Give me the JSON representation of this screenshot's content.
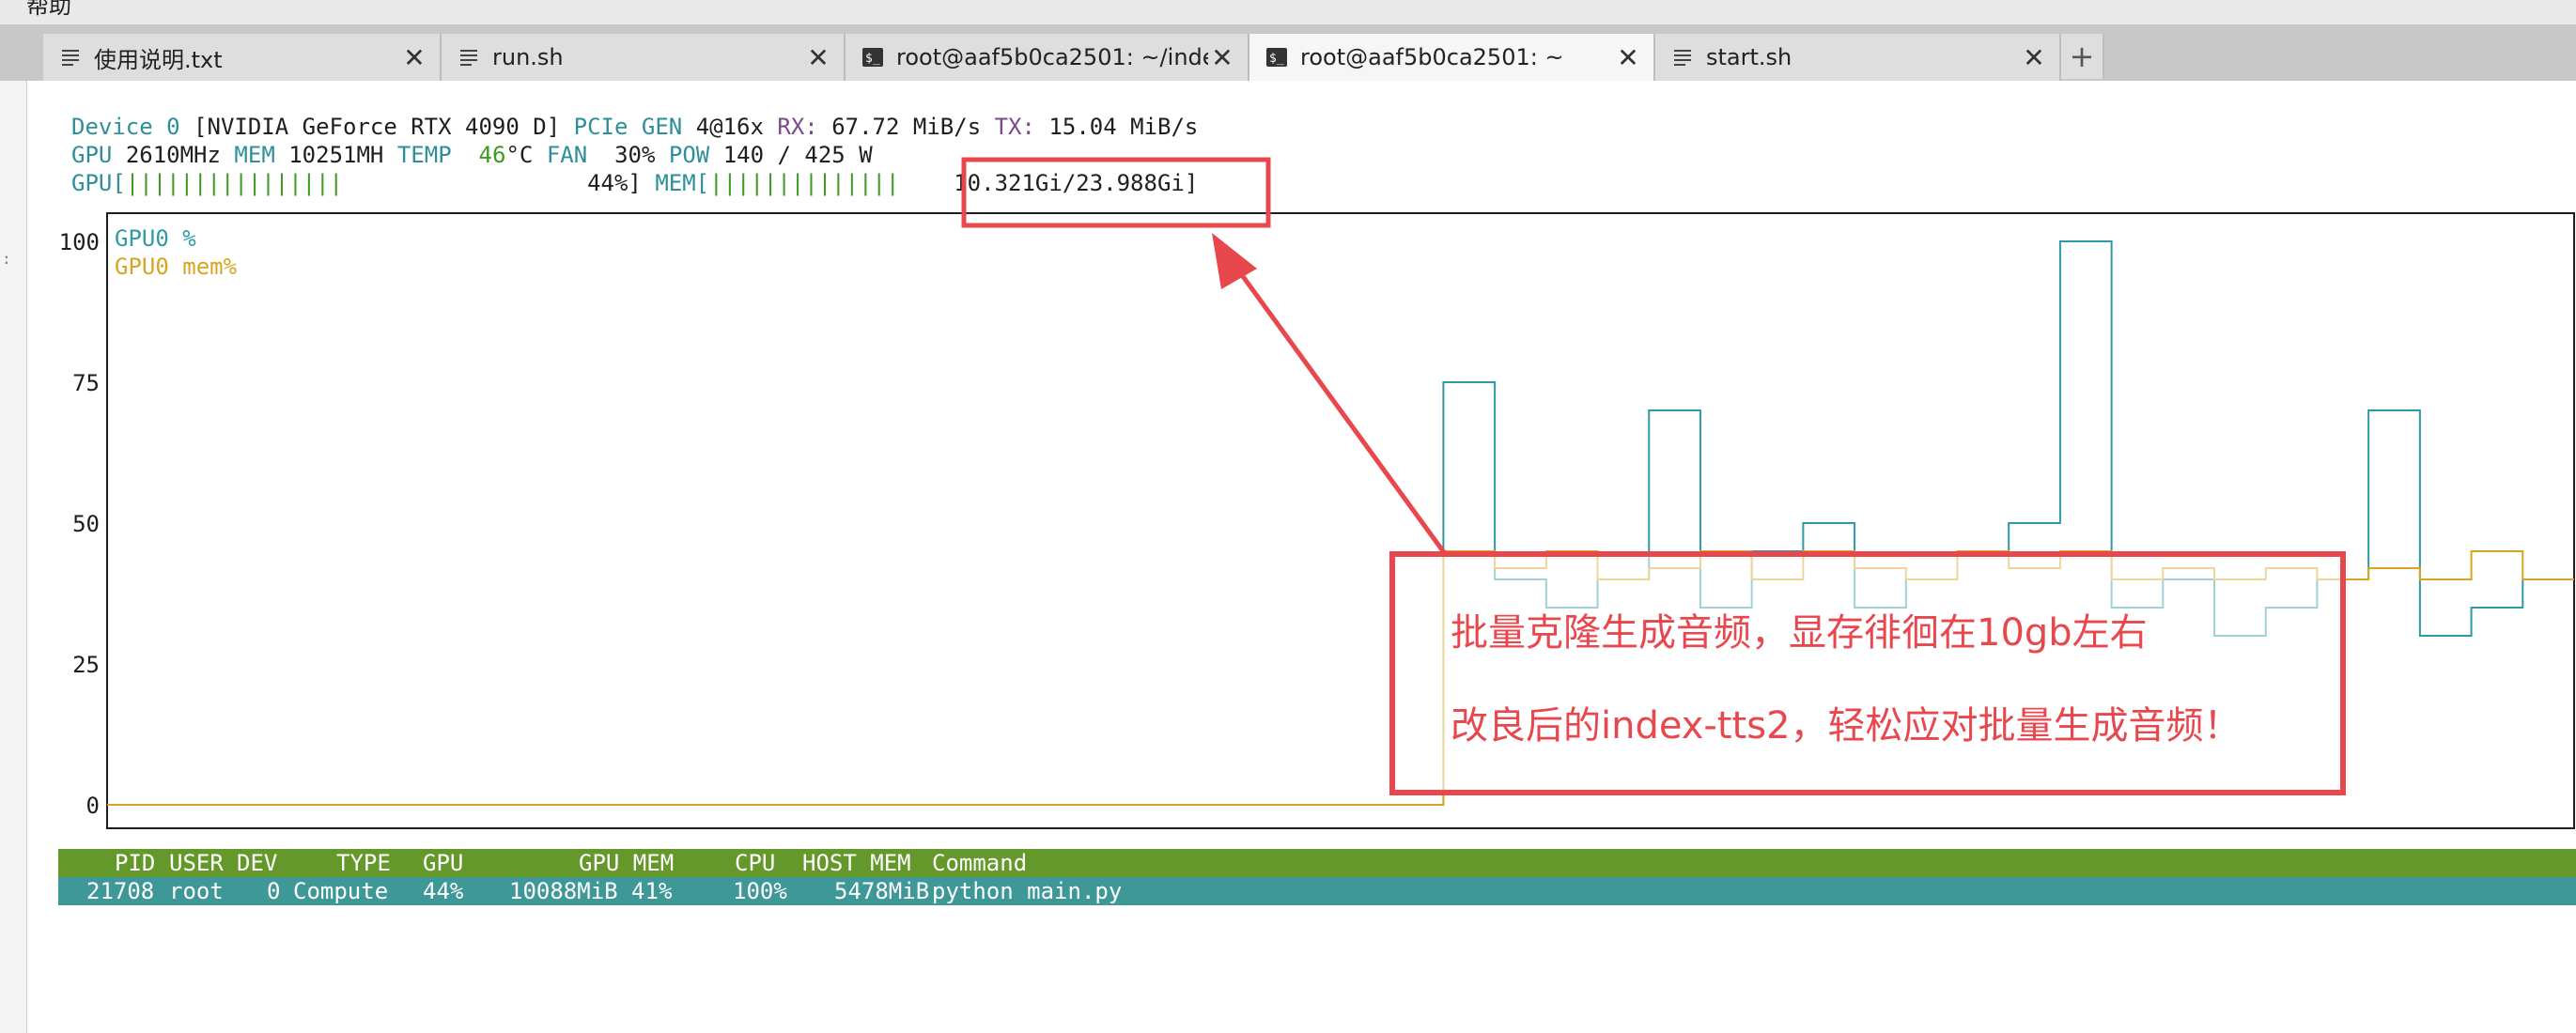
{
  "menubar": {
    "label": "帮助"
  },
  "tabs": [
    {
      "title": "使用说明.txt",
      "icon": "text-file-icon",
      "active": false
    },
    {
      "title": "run.sh",
      "icon": "text-file-icon",
      "active": false
    },
    {
      "title": "root@aaf5b0ca2501: ~/inde",
      "icon": "terminal-icon",
      "active": false
    },
    {
      "title": "root@aaf5b0ca2501: ~",
      "icon": "terminal-icon",
      "active": true
    },
    {
      "title": "start.sh",
      "icon": "text-file-icon",
      "active": false
    }
  ],
  "tab_close_glyph": "✕",
  "tab_add_glyph": "+",
  "device": {
    "label": "Device 0",
    "name": "[NVIDIA GeForce RTX 4090 D]",
    "pcie_label": "PCIe GEN",
    "pcie_value": "4@16x",
    "rx_label": "RX:",
    "rx_value": "67.72 MiB/s",
    "tx_label": "TX:",
    "tx_value": "15.04 MiB/s"
  },
  "stats": {
    "gpu_label": "GPU",
    "gpu_clock": "2610MHz",
    "mem_label": "MEM",
    "mem_clock": "10251MH",
    "temp_label": "TEMP",
    "temp_value": "46",
    "temp_unit": "°C",
    "fan_label": "FAN",
    "fan_value": "30%",
    "pow_label": "POW",
    "pow_value": "140 / 425 W"
  },
  "bars": {
    "gpu_label": "GPU[",
    "gpu_ticks": "||||||||||||||||",
    "gpu_percent": "44%]",
    "mem_label": "MEM[",
    "mem_ticks": "||||||||||||||",
    "mem_value": "10.321Gi/23.988Gi]"
  },
  "chart_data": {
    "type": "line",
    "y_ticks": [
      "100",
      "75",
      "50",
      "25",
      "0"
    ],
    "ylim": [
      0,
      100
    ],
    "x": [
      0,
      26,
      27,
      28,
      29,
      30,
      31,
      32,
      33,
      34,
      35,
      36,
      37,
      38,
      39,
      40,
      41,
      42,
      43,
      44,
      45,
      46,
      47
    ],
    "series": [
      {
        "name": "GPU0 %",
        "color": "#2e9aa6",
        "values": [
          0,
          75,
          40,
          35,
          40,
          70,
          35,
          45,
          50,
          35,
          40,
          45,
          50,
          100,
          35,
          40,
          30,
          35,
          40,
          70,
          30,
          35,
          40
        ]
      },
      {
        "name": "GPU0 mem%",
        "color": "#d9a520",
        "values": [
          0,
          45,
          42,
          45,
          40,
          42,
          45,
          40,
          45,
          42,
          40,
          45,
          42,
          45,
          40,
          42,
          40,
          42,
          40,
          42,
          40,
          45,
          40
        ]
      }
    ]
  },
  "processes": {
    "header": [
      "PID",
      "USER",
      "DEV",
      "TYPE",
      "GPU",
      "GPU MEM",
      "CPU",
      "HOST MEM",
      "Command"
    ],
    "rows": [
      [
        "21708",
        "root",
        "0",
        "Compute",
        "44%",
        "10088MiB 41%",
        "100%",
        "5478MiB",
        "python main.py"
      ]
    ]
  },
  "annotation": {
    "line1": "批量克隆生成音频，显存徘徊在10gb左右",
    "line2": "改良后的index-tts2，轻松应对批量生成音频！",
    "color": "#e8474e"
  }
}
